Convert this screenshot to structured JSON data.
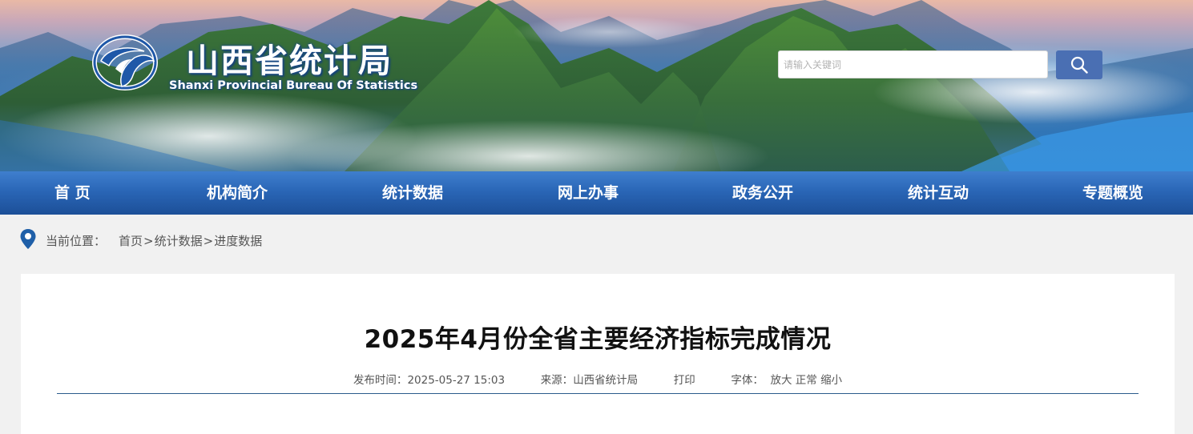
{
  "header": {
    "site_title": "山西省统计局",
    "site_subtitle": "Shanxi Provincial Bureau Of Statistics",
    "logo_icon": "bureau-emblem-icon"
  },
  "search": {
    "placeholder": "请输入关键词",
    "button_icon": "search-icon"
  },
  "nav": {
    "items": [
      {
        "label": "首  页"
      },
      {
        "label": "机构简介"
      },
      {
        "label": "统计数据"
      },
      {
        "label": "网上办事"
      },
      {
        "label": "政务公开"
      },
      {
        "label": "统计互动"
      },
      {
        "label": "专题概览"
      }
    ]
  },
  "breadcrumb": {
    "label": "当前位置：",
    "items": [
      "首页",
      "统计数据",
      "进度数据"
    ],
    "separator": ">"
  },
  "article": {
    "title": "2025年4月份全省主要经济指标完成情况",
    "publish_label": "发布时间：",
    "publish_time": "2025-05-27 15:03",
    "source_label": "来源：",
    "source": "山西省统计局",
    "print_label": "打印",
    "font_label": "字体：",
    "font_larger": "放大",
    "font_normal": "正常",
    "font_smaller": "缩小"
  },
  "colors": {
    "nav_top": "#3f7fce",
    "nav_bottom": "#1c4f98",
    "search_button": "#4a6fb3",
    "divider": "#2a5b8c",
    "page_bg": "#f1f1f1"
  }
}
